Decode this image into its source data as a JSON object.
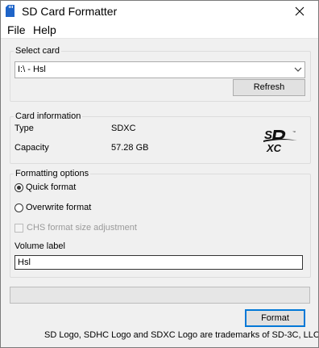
{
  "window": {
    "title": "SD Card Formatter",
    "close_symbol": "✕"
  },
  "menu": {
    "items": [
      "File",
      "Help"
    ]
  },
  "select_card": {
    "group_label": "Select card",
    "selected_value": "I:\\ - Hsl",
    "refresh_label": "Refresh"
  },
  "card_info": {
    "group_label": "Card information",
    "type_label": "Type",
    "type_value": "SDXC",
    "capacity_label": "Capacity",
    "capacity_value": "57.28 GB",
    "logo_icon": "sdxc-logo-icon"
  },
  "formatting": {
    "group_label": "Formatting options",
    "quick_format_label": "Quick format",
    "quick_format_selected": true,
    "overwrite_format_label": "Overwrite format",
    "overwrite_format_selected": false,
    "chs_label": "CHS format size adjustment",
    "chs_checked": false,
    "chs_enabled": false,
    "volume_label_caption": "Volume label",
    "volume_label_value": "Hsl"
  },
  "progress": {
    "fraction": 0
  },
  "actions": {
    "format_label": "Format"
  },
  "footer": {
    "trademark_text": "SD Logo, SDHC Logo and SDXC Logo are trademarks of SD-3C, LLC."
  },
  "colors": {
    "accent": "#0078d7",
    "window_bg": "#f0f0f0",
    "disabled_text": "#9a9a9a"
  }
}
